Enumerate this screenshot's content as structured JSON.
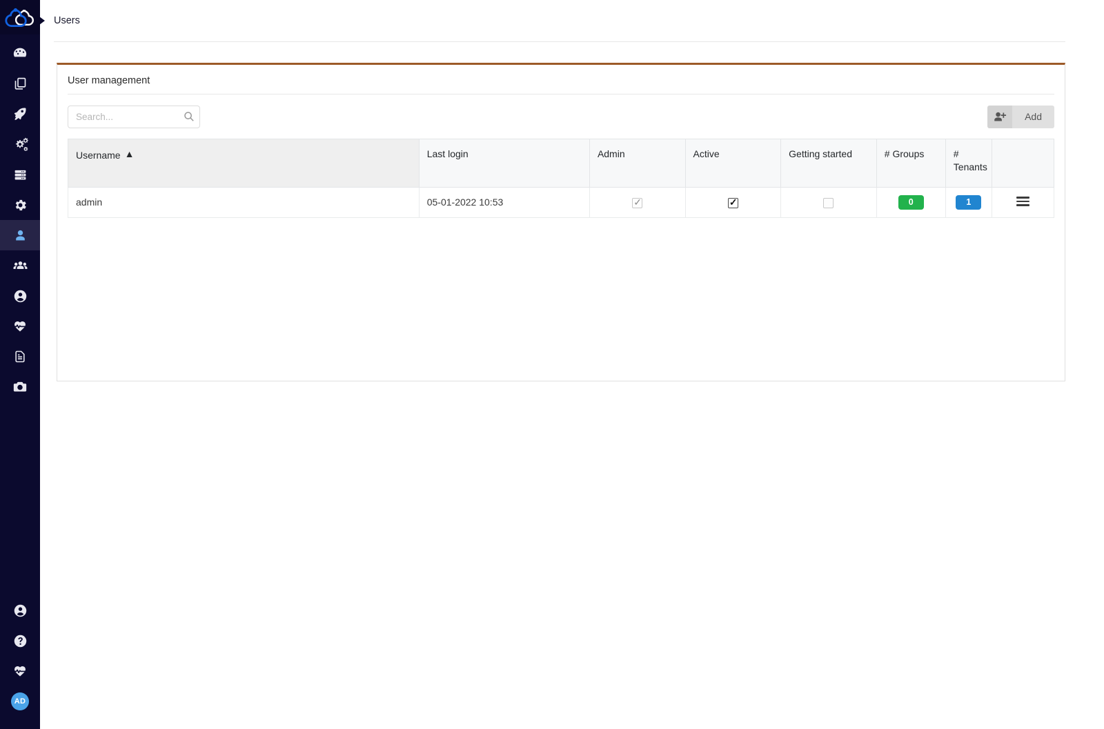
{
  "app": {
    "logo_icon": "cloud-logo-icon",
    "accent_blue": "#1161e0",
    "sidebar_bg": "#0b0a2e",
    "panel_top_border": "#9c5a28"
  },
  "topbar": {
    "breadcrumb": "Users",
    "breadcrumb_arrow_icon": "chevron-right-icon"
  },
  "sidebar": {
    "items": [
      {
        "name": "dashboard",
        "icon": "gauge-icon",
        "active": false
      },
      {
        "name": "blueprints",
        "icon": "copy-files-icon",
        "active": false
      },
      {
        "name": "deployments",
        "icon": "rocket-icon",
        "active": false
      },
      {
        "name": "services",
        "icon": "cogs-icon",
        "active": false
      },
      {
        "name": "hosts",
        "icon": "server-icon",
        "active": false
      },
      {
        "name": "system",
        "icon": "gear-icon",
        "active": false
      },
      {
        "name": "users",
        "icon": "user-icon",
        "active": true
      },
      {
        "name": "user-groups",
        "icon": "users-group-icon",
        "active": false
      },
      {
        "name": "tenants",
        "icon": "user-circle-icon",
        "active": false
      },
      {
        "name": "health",
        "icon": "heartbeat-icon",
        "active": false
      },
      {
        "name": "logs",
        "icon": "file-document-icon",
        "active": false
      },
      {
        "name": "snapshots",
        "icon": "camera-icon",
        "active": false
      }
    ],
    "bottom_items": [
      {
        "name": "account",
        "icon": "user-circle-icon"
      },
      {
        "name": "help",
        "icon": "question-circle-icon"
      },
      {
        "name": "status",
        "icon": "heartbeat-icon"
      }
    ],
    "avatar": {
      "initials": "AD",
      "color": "#4aa3e8"
    }
  },
  "panel": {
    "title": "User management",
    "search": {
      "placeholder": "Search...",
      "value": "",
      "icon": "search-icon"
    },
    "add_button": {
      "label": "Add",
      "icon": "user-plus-icon"
    },
    "table": {
      "columns": [
        {
          "key": "username",
          "label": "Username",
          "sorted": true,
          "sort_dir": "asc",
          "sort_caret": "▲"
        },
        {
          "key": "last_login",
          "label": "Last login",
          "sorted": false
        },
        {
          "key": "admin",
          "label": "Admin",
          "sorted": false
        },
        {
          "key": "active",
          "label": "Active",
          "sorted": false
        },
        {
          "key": "getting_started",
          "label": "Getting started",
          "sorted": false
        },
        {
          "key": "groups",
          "label": "# Groups",
          "sorted": false
        },
        {
          "key": "tenants",
          "label": "# Tenants",
          "sorted": false
        },
        {
          "key": "actions",
          "label": "",
          "sorted": false
        }
      ],
      "rows": [
        {
          "username": "admin",
          "last_login": "05-01-2022 10:53",
          "admin_checked": true,
          "admin_disabled": true,
          "active_checked": true,
          "active_disabled": false,
          "getting_started_checked": false,
          "groups_count": "0",
          "groups_color": "#22b24c",
          "tenants_count": "1",
          "tenants_color": "#2185d0",
          "row_menu_icon": "hamburger-menu-icon"
        }
      ]
    }
  }
}
